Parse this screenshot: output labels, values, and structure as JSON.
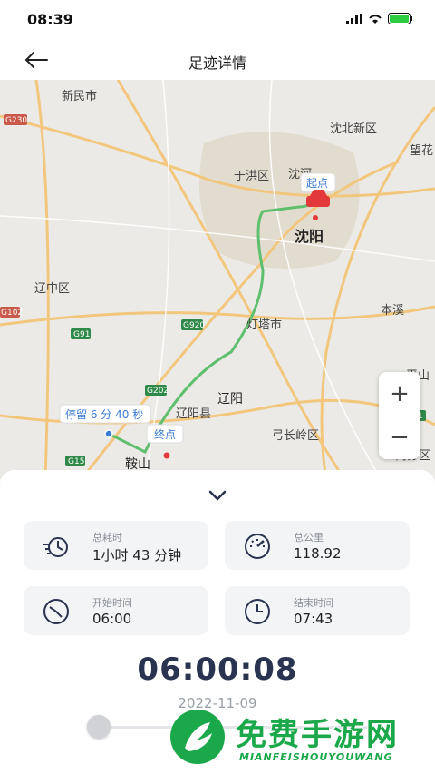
{
  "status": {
    "time": "08:39"
  },
  "header": {
    "title": "足迹详情"
  },
  "map": {
    "places": [
      "新民市",
      "沈北新区",
      "望花",
      "于洪区",
      "沈河",
      "沈阳",
      "辽中区",
      "本溪",
      "灯塔市",
      "辽阳",
      "辽阳县",
      "弓长岭区",
      "平山",
      "鞍山",
      "南芬区"
    ],
    "road_tags": [
      "G230",
      "G102",
      "G91",
      "G920",
      "G202",
      "G15",
      "G1"
    ],
    "start_label": "起点",
    "end_label": "终点",
    "stay_label": "停留 6 分 40 秒",
    "zoom_in": "+",
    "zoom_out": "−"
  },
  "stats": {
    "duration": {
      "label": "总耗时",
      "value": "1小时 43 分钟",
      "icon": "stopwatch-icon"
    },
    "distance": {
      "label": "总公里",
      "value": "118.92",
      "icon": "speedometer-icon"
    },
    "start": {
      "label": "开始时间",
      "value": "06:00",
      "icon": "clock-icon"
    },
    "end": {
      "label": "结束时间",
      "value": "07:43",
      "icon": "clock-icon"
    }
  },
  "playback": {
    "time": "06:00:08",
    "date": "2022-11-09"
  },
  "watermark": {
    "cn": "免费手游网",
    "en": "MIANFEISHOUYOUWANG"
  },
  "colors": {
    "route": "#5fbf6e",
    "start_marker": "#e4393c",
    "stay_point": "#3a7bd5",
    "time_text": "#2a3450",
    "watermark": "#1aa84a"
  }
}
